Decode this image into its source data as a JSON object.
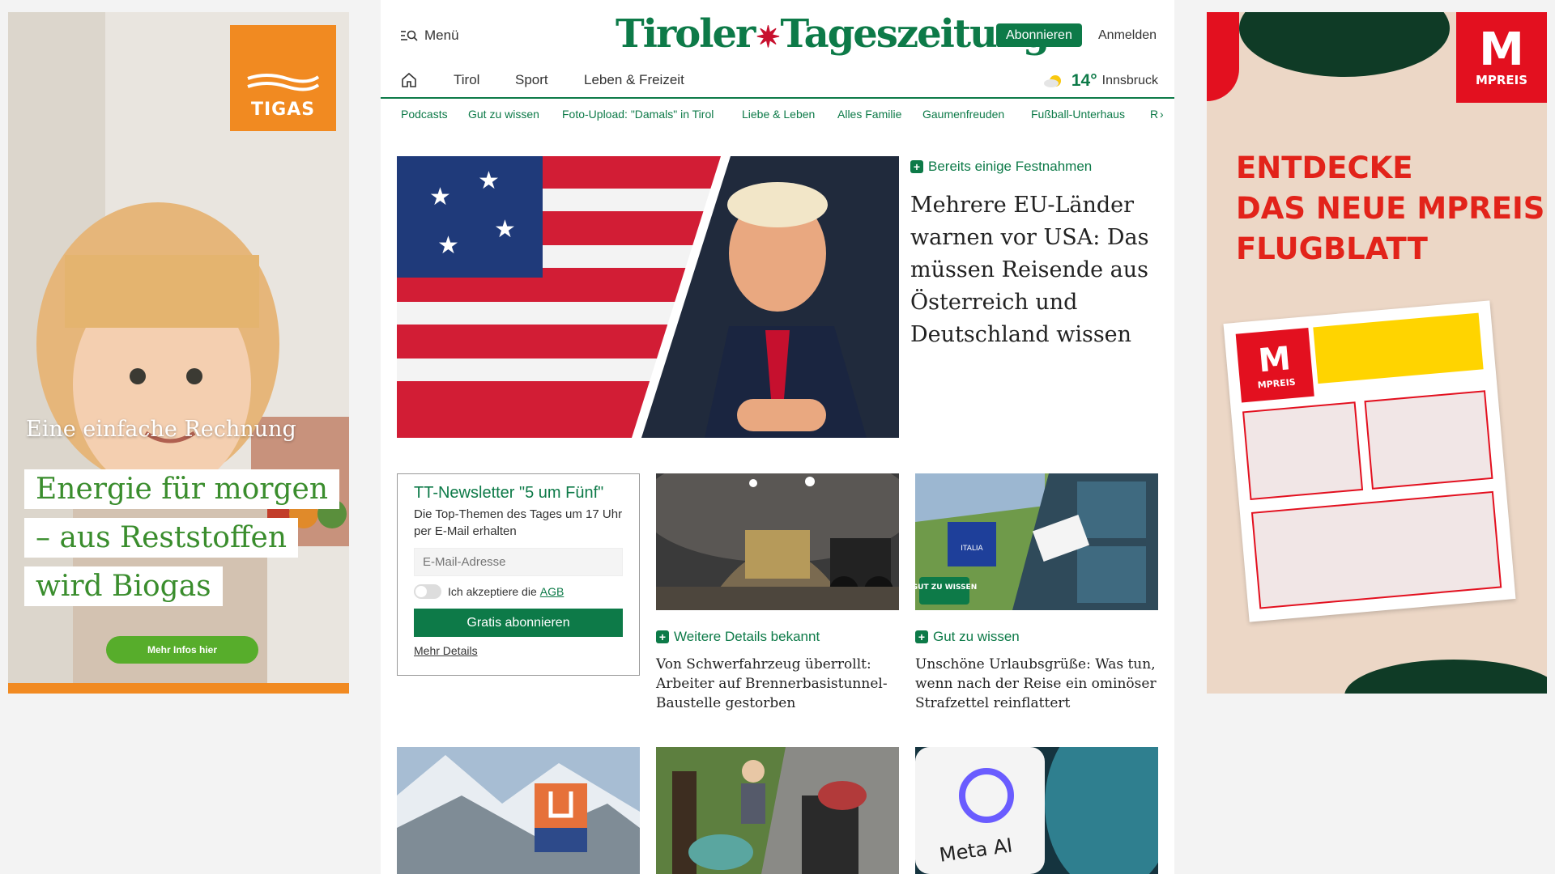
{
  "ads": {
    "left": {
      "brand": "TIGAS",
      "headline": "Eine einfache Rechnung",
      "lines": [
        "Energie für morgen",
        "– aus Reststoffen",
        "wird Biogas"
      ],
      "cta": "Mehr Infos hier"
    },
    "right": {
      "brand": "MPREIS",
      "brand_letter": "M",
      "lines": [
        "ENTDECKE",
        "DAS NEUE MPREIS",
        "FLUGBLATT"
      ]
    }
  },
  "header": {
    "menu_label": "Menü",
    "logo_part1": "Tiroler",
    "logo_part2": "Tageszeitung",
    "subscribe": "Abonnieren",
    "login": "Anmelden"
  },
  "nav": {
    "items": [
      "Tirol",
      "Sport",
      "Leben & Freizeit"
    ]
  },
  "weather": {
    "temp": "14°",
    "city": "Innsbruck"
  },
  "subnav": {
    "items": [
      "Podcasts",
      "Gut zu wissen",
      "Foto-Upload: \"Damals\" in Tirol",
      "Liebe & Leben",
      "Alles Familie",
      "Gaumenfreuden",
      "Fußball-Unterhaus",
      "R"
    ]
  },
  "hero": {
    "kicker": "Bereits einige Festnahmen",
    "title": "Mehrere EU-Länder warnen vor USA: Das müssen Reisende aus Österreich und Deutschland wissen"
  },
  "newsletter": {
    "title": "TT-Newsletter \"5 um Fünf\"",
    "description": "Die Top-Themen des Tages um 17 Uhr per E-Mail erhalten",
    "email_placeholder": "E-Mail-Adresse",
    "accept_label": "Ich akzeptiere die",
    "agb": "AGB",
    "button": "Gratis abonnieren",
    "more": "Mehr Details"
  },
  "cards": [
    {
      "kicker": "Weitere Details bekannt",
      "title": "Von Schwerfahrzeug überrollt: Arbeiter auf Brennerbasistunnel-Baustelle gestorben"
    },
    {
      "kicker": "Gut zu wissen",
      "title": "Unschöne Urlaubsgrüße: Was tun, wenn nach der Reise ein ominöser Strafzettel reinflattert",
      "badge": "GUT ZU WISSEN",
      "sign": "ITALIA"
    }
  ],
  "bottom": {
    "meta_label": "Meta AI"
  },
  "colors": {
    "brand_green": "#0d7a48",
    "tigas_orange": "#f18a21",
    "mpreis_red": "#e3101f"
  }
}
